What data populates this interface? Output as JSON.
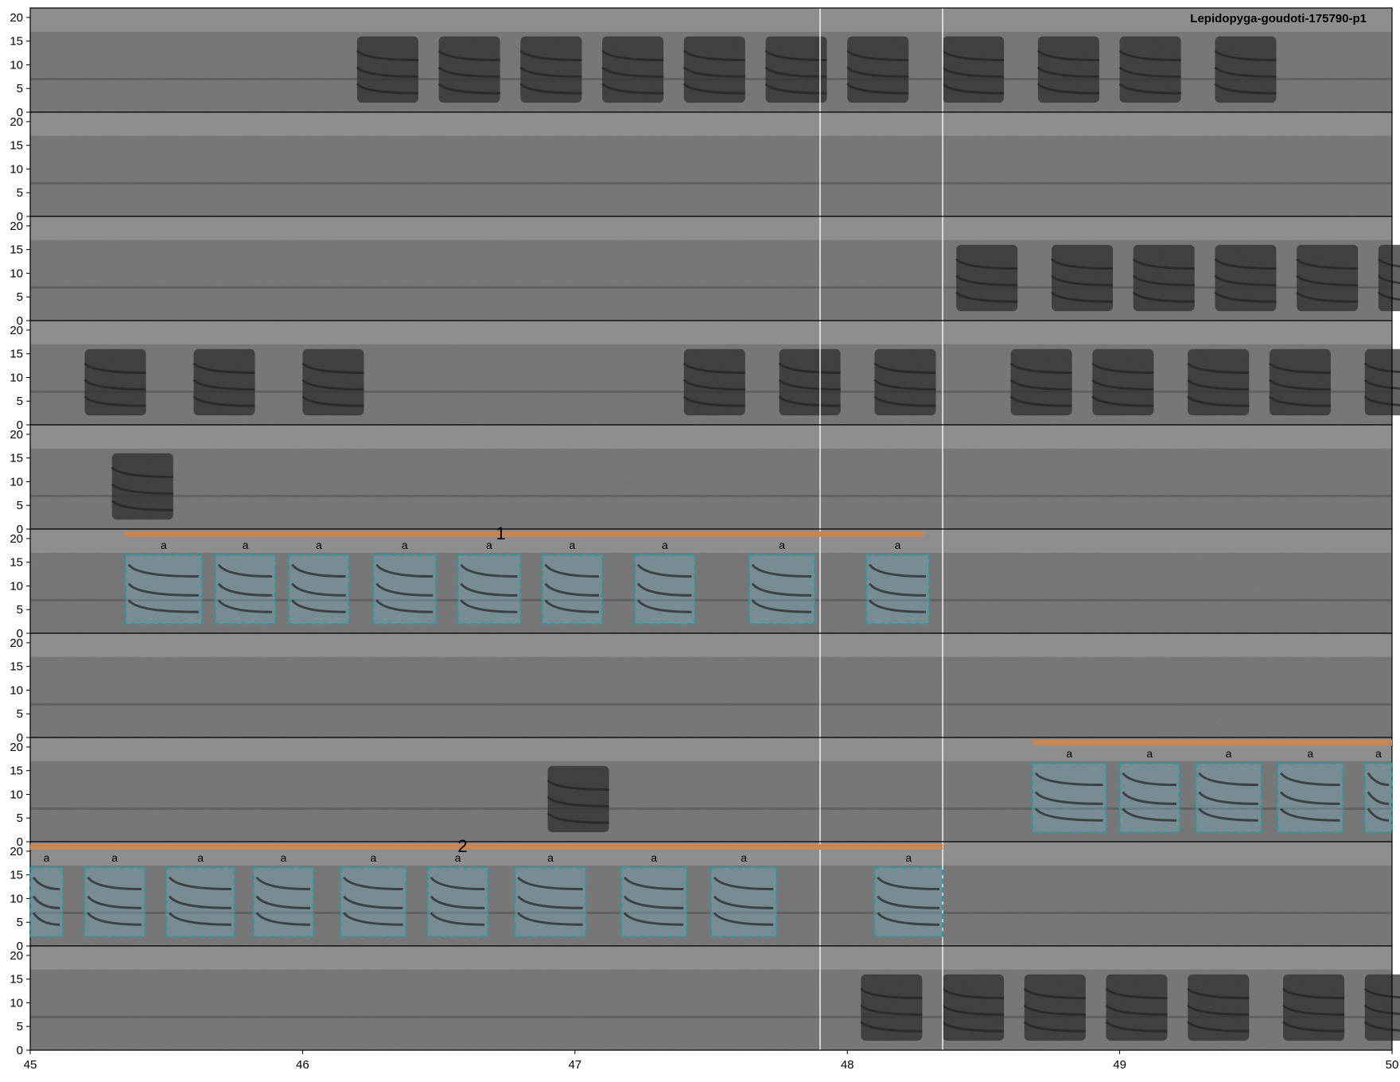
{
  "chart_data": {
    "type": "spectrogram",
    "title": "Lepidopyga-goudoti-175790-p1",
    "xlabel": "",
    "ylabel": "",
    "y_ticks": [
      0,
      5,
      10,
      15,
      20
    ],
    "ylim": [
      0,
      22
    ],
    "x_ticks": [
      45,
      46,
      47,
      48,
      49,
      50
    ],
    "xlim": [
      45,
      50
    ],
    "panel_count": 10,
    "dividers": [
      47.9,
      48.35
    ],
    "panels": [
      {
        "row": 0,
        "calls": [
          46.2,
          46.5,
          46.8,
          47.1,
          47.4,
          47.7,
          48.0,
          48.35,
          48.7,
          49.0,
          49.35
        ]
      },
      {
        "row": 1,
        "calls": []
      },
      {
        "row": 2,
        "calls": [
          48.4,
          48.75,
          49.05,
          49.35,
          49.65,
          49.95
        ]
      },
      {
        "row": 3,
        "calls": [
          45.2,
          45.6,
          46.0,
          47.4,
          47.75,
          48.1,
          48.6,
          48.9,
          49.25,
          49.55,
          49.9
        ]
      },
      {
        "row": 4,
        "calls": [
          45.3
        ]
      },
      {
        "row": 5,
        "calls": []
      },
      {
        "row": 6,
        "calls": []
      },
      {
        "row": 7,
        "calls": [
          46.9
        ]
      },
      {
        "row": 8,
        "calls": []
      },
      {
        "row": 9,
        "calls": [
          48.05,
          48.35,
          48.65,
          48.95,
          49.25,
          49.6,
          49.9
        ]
      }
    ],
    "phrases": [
      {
        "label": "1",
        "row": 5,
        "start": 45.35,
        "end": 48.28,
        "syllables": [
          {
            "label": "a",
            "start": 45.35,
            "end": 45.63
          },
          {
            "label": "a",
            "start": 45.68,
            "end": 45.9
          },
          {
            "label": "a",
            "start": 45.95,
            "end": 46.17
          },
          {
            "label": "a",
            "start": 46.26,
            "end": 46.49
          },
          {
            "label": "a",
            "start": 46.57,
            "end": 46.8
          },
          {
            "label": "a",
            "start": 46.88,
            "end": 47.1
          },
          {
            "label": "a",
            "start": 47.22,
            "end": 47.44
          },
          {
            "label": "a",
            "start": 47.64,
            "end": 47.88
          },
          {
            "label": "a",
            "start": 48.07,
            "end": 48.3
          }
        ]
      },
      {
        "label": "",
        "row": 7,
        "start": 48.68,
        "end": 50.0,
        "syllables": [
          {
            "label": "a",
            "start": 48.68,
            "end": 48.95
          },
          {
            "label": "a",
            "start": 49.0,
            "end": 49.22
          },
          {
            "label": "a",
            "start": 49.28,
            "end": 49.52
          },
          {
            "label": "a",
            "start": 49.58,
            "end": 49.82
          },
          {
            "label": "a",
            "start": 49.9,
            "end": 50.0
          }
        ]
      },
      {
        "label": "2",
        "row": 8,
        "start": 45.0,
        "end": 48.35,
        "syllables": [
          {
            "label": "a",
            "start": 45.0,
            "end": 45.12
          },
          {
            "label": "a",
            "start": 45.2,
            "end": 45.42
          },
          {
            "label": "a",
            "start": 45.5,
            "end": 45.75
          },
          {
            "label": "a",
            "start": 45.82,
            "end": 46.04
          },
          {
            "label": "a",
            "start": 46.14,
            "end": 46.38
          },
          {
            "label": "a",
            "start": 46.46,
            "end": 46.68
          },
          {
            "label": "a",
            "start": 46.78,
            "end": 47.04
          },
          {
            "label": "a",
            "start": 47.17,
            "end": 47.41
          },
          {
            "label": "a",
            "start": 47.5,
            "end": 47.74
          },
          {
            "label": "a",
            "start": 48.1,
            "end": 48.35
          }
        ]
      }
    ]
  }
}
